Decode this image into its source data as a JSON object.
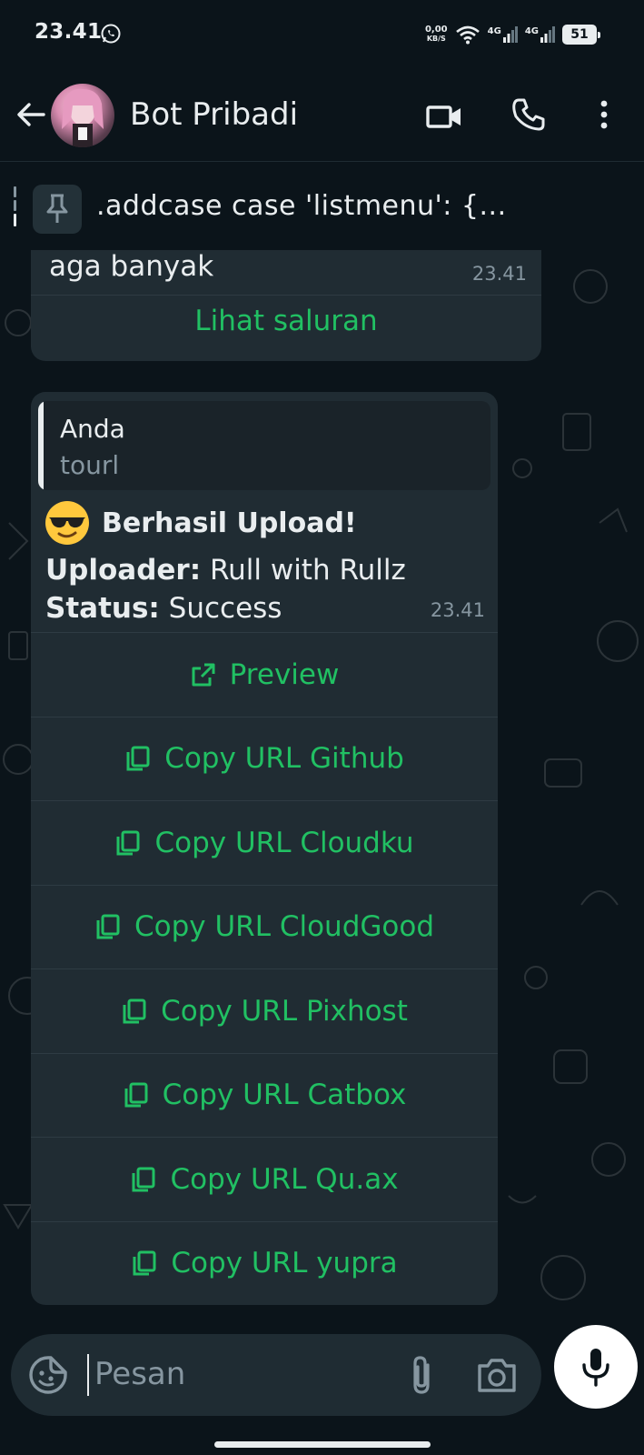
{
  "status_bar": {
    "time": "23.41",
    "speed_top": "0,00",
    "speed_bottom": "KB/S",
    "net1": "4G",
    "net2": "4G",
    "battery": "51"
  },
  "header": {
    "title": "Bot Pribadi"
  },
  "pinned": {
    "text": ".addcase case 'listmenu': {..."
  },
  "previous_message": {
    "text": "aga banyak",
    "time": "23.41",
    "action_label": "Lihat saluran"
  },
  "message": {
    "quote_name": "Anda",
    "quote_text": "tourl",
    "title": "Berhasil Upload!",
    "uploader_label": "Uploader:",
    "uploader_value": "Rull with Rullz",
    "status_label": "Status:",
    "status_value": "Success",
    "time": "23.41"
  },
  "buttons": [
    {
      "label": "Preview",
      "icon": "external-link-icon"
    },
    {
      "label": "Copy URL Github",
      "icon": "copy-icon"
    },
    {
      "label": "Copy URL Cloudku",
      "icon": "copy-icon"
    },
    {
      "label": "Copy URL CloudGood",
      "icon": "copy-icon"
    },
    {
      "label": "Copy URL Pixhost",
      "icon": "copy-icon"
    },
    {
      "label": "Copy URL Catbox",
      "icon": "copy-icon"
    },
    {
      "label": "Copy URL Qu.ax",
      "icon": "copy-icon"
    },
    {
      "label": "Copy URL yupra",
      "icon": "copy-icon"
    }
  ],
  "input": {
    "placeholder": "Pesan"
  },
  "colors": {
    "background": "#0b141a",
    "bubble": "#202c33",
    "accent_green": "#21c063",
    "muted": "#8696a0",
    "text": "#e9edef"
  }
}
